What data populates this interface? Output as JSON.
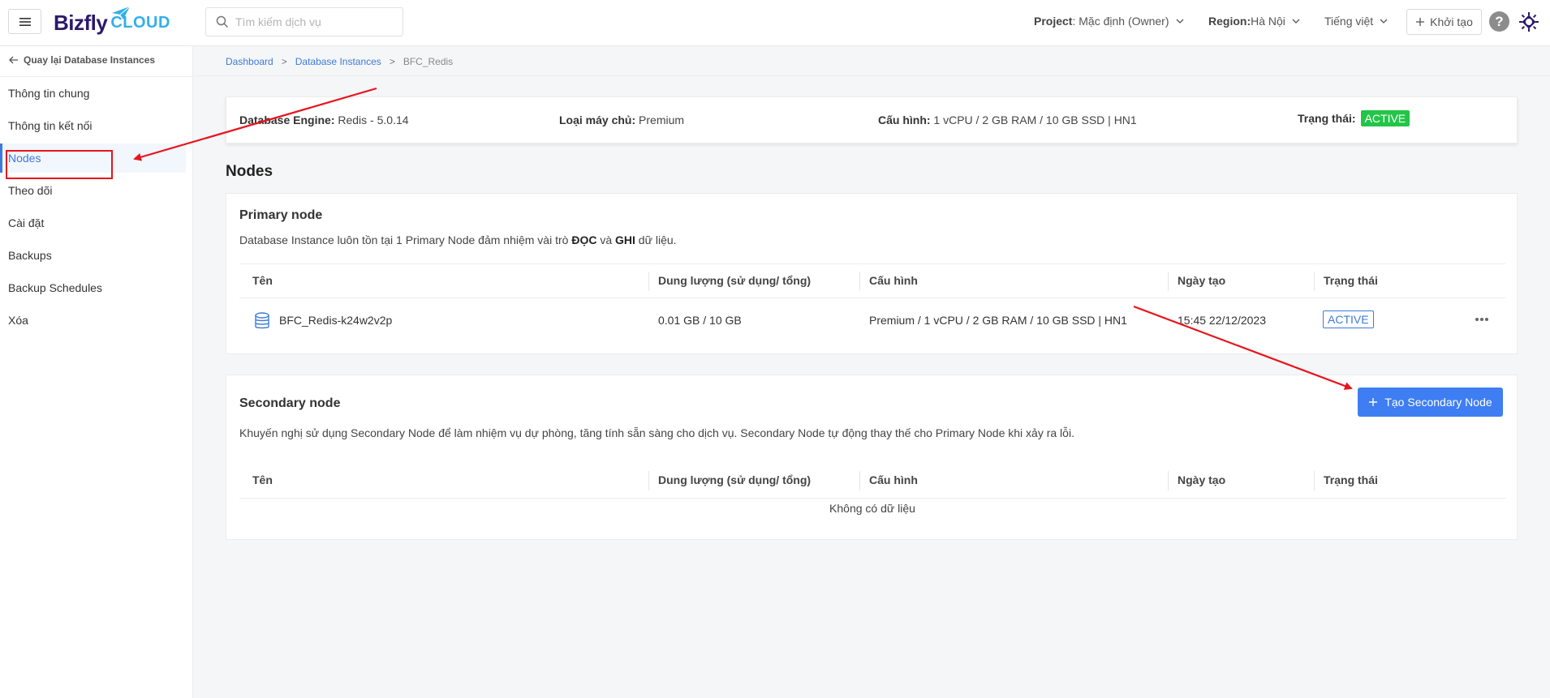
{
  "header": {
    "search_placeholder": "Tìm kiếm dịch vụ",
    "project_label": "Project",
    "project_value": ": Mặc định (Owner)",
    "region_label": "Region:",
    "region_value": " Hà Nội",
    "language": "Tiếng việt",
    "create_label": "Khởi tạo",
    "help_glyph": "?"
  },
  "logo": {
    "brand": "Bizfly",
    "suffix": "CLOUD"
  },
  "sidebar": {
    "back_label": "Quay lại Database Instances",
    "items": [
      {
        "label": "Thông tin chung"
      },
      {
        "label": "Thông tin kết nối"
      },
      {
        "label": "Nodes"
      },
      {
        "label": "Theo dõi"
      },
      {
        "label": "Cài đặt"
      },
      {
        "label": "Backups"
      },
      {
        "label": "Backup Schedules"
      },
      {
        "label": "Xóa"
      }
    ],
    "active_index": 2
  },
  "breadcrumb": {
    "items": [
      "Dashboard",
      "Database Instances",
      "BFC_Redis"
    ],
    "separator": ">"
  },
  "info": {
    "engine_label": "Database Engine:",
    "engine_value": " Redis - 5.0.14",
    "server_label": "Loại máy chủ:",
    "server_value": " Premium",
    "config_label": "Cấu hình:",
    "config_value": " 1 vCPU / 2 GB RAM / 10 GB SSD | HN1",
    "status_label": "Trạng thái:",
    "status_value": "ACTIVE"
  },
  "page_title": "Nodes",
  "table_headers": [
    "Tên",
    "Dung lượng (sử dụng/ tổng)",
    "Cấu hình",
    "Ngày tạo",
    "Trạng thái"
  ],
  "primary": {
    "title": "Primary node",
    "desc_1": "Database Instance luôn tồn tại 1 Primary Node đảm nhiệm vài trò ",
    "desc_b1": "ĐỌC",
    "desc_2": " và ",
    "desc_b2": "GHI",
    "desc_3": " dữ liệu.",
    "row": {
      "name": "BFC_Redis-k24w2v2p",
      "capacity": "0.01 GB / 10 GB",
      "config": "Premium / 1 vCPU / 2 GB RAM / 10 GB SSD | HN1",
      "created": "15:45 22/12/2023",
      "status": "ACTIVE"
    }
  },
  "secondary": {
    "title": "Secondary node",
    "desc": "Khuyến nghị sử dụng Secondary Node để làm nhiệm vụ dự phòng, tăng tính sẵn sàng cho dịch vụ. Secondary Node tự động thay thế cho Primary Node khi xảy ra lỗi.",
    "create_label": "Tạo Secondary Node",
    "empty_text": "Không có dữ liệu"
  },
  "colors": {
    "accent": "#3e7bd9",
    "primary_button": "#3e7ef2",
    "active_green": "#23c548",
    "annotation_red": "#e8141c"
  }
}
